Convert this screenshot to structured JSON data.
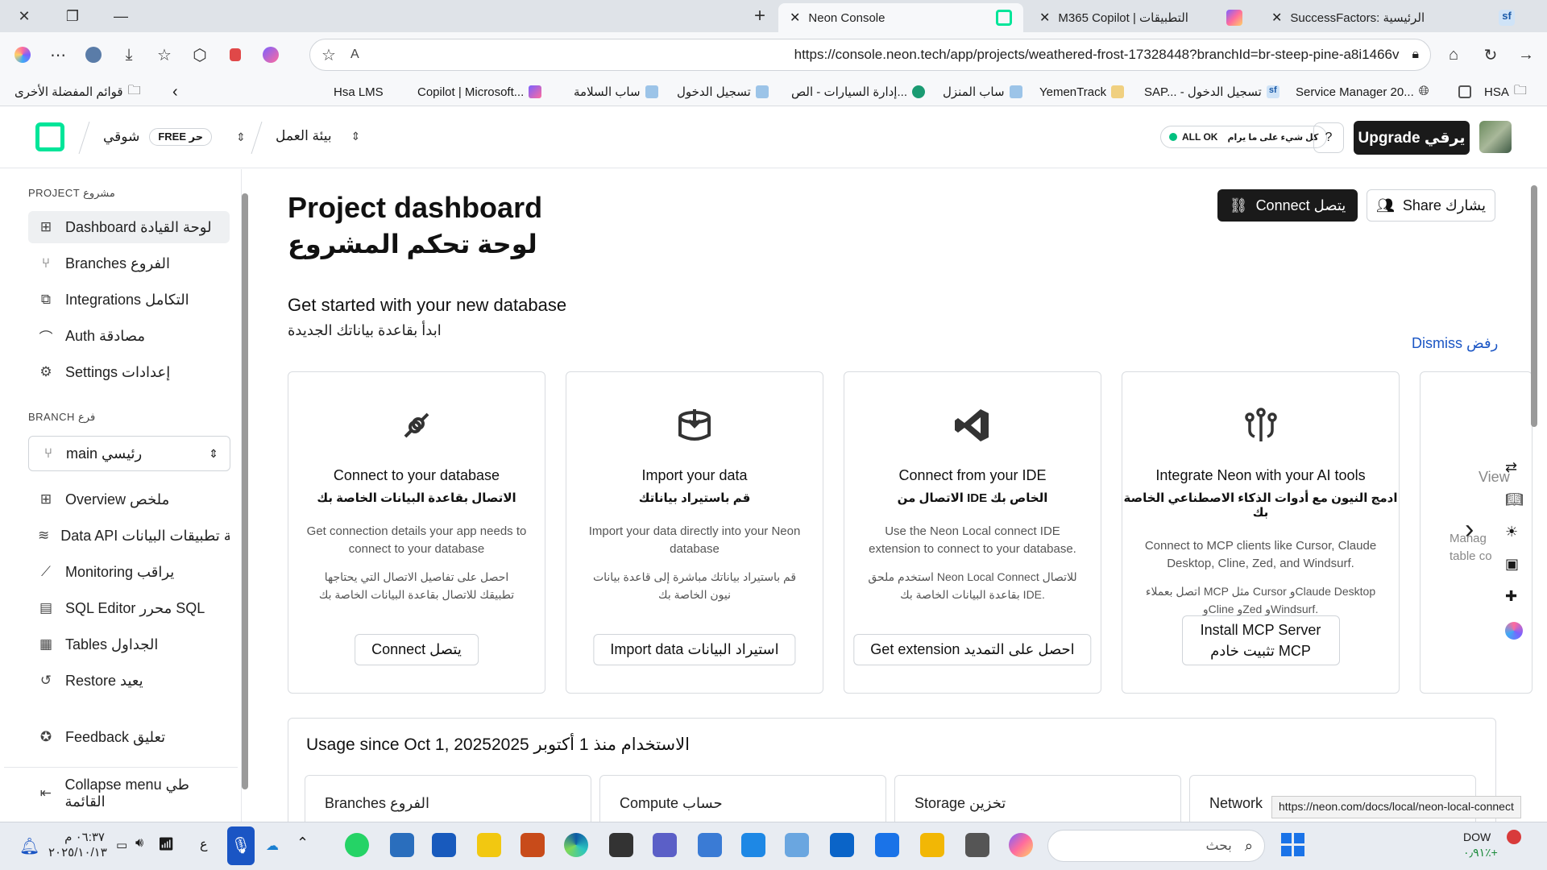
{
  "browser": {
    "tabs": [
      {
        "title": "Neon Console",
        "active": true
      },
      {
        "title": "M365 Copilot | التطبيقات",
        "active": false
      },
      {
        "title": "SuccessFactors: الرئيسية",
        "active": false
      }
    ],
    "url": "https://console.neon.tech/app/projects/weathered-frost-17328448?branchId=br-steep-pine-a8i1466v",
    "bookmarks": [
      "Hsa LMS",
      "Copilot | Microsoft...",
      "ساب السلامة",
      "تسجيل الدخول",
      "إدارة السيارات - الص...",
      "ساب المنزل",
      "YemenTrack",
      "SAP... - تسجيل الدخول",
      "Service Manager 20...",
      "HSA"
    ],
    "other_favorites": "قوائم المفضلة الأخرى"
  },
  "header": {
    "org_name": "شوقي",
    "plan_badge": "FREE حر",
    "workspace": "بيئة العمل",
    "status_label": "ALL OK",
    "status_sub": "كل شيء على ما يرام",
    "help_icon": "?",
    "upgrade_label": "Upgrade يرقي"
  },
  "sidebar": {
    "project_section": "PROJECT مشروع",
    "project_items": [
      {
        "label": "Dashboard لوحة القيادة",
        "icon": "dashboard-icon"
      },
      {
        "label": "Branches الفروع",
        "icon": "branch-icon"
      },
      {
        "label": "Integrations التكامل",
        "icon": "integrations-icon"
      },
      {
        "label": "Auth مصادقة",
        "icon": "auth-icon"
      },
      {
        "label": "Settings إعدادات",
        "icon": "gear-icon"
      }
    ],
    "branch_section": "BRANCH فرع",
    "branch_value": "main رئيسي",
    "branch_items": [
      {
        "label": "Overview ملخص",
        "icon": "overview-icon"
      },
      {
        "label": "Data API برمجة تطبيقات البيانات",
        "icon": "data-api-icon"
      },
      {
        "label": "Monitoring يراقب",
        "icon": "monitoring-icon"
      },
      {
        "label": "SQL Editor محرر SQL",
        "icon": "sql-icon"
      },
      {
        "label": "Tables الجداول",
        "icon": "tables-icon"
      },
      {
        "label": "Restore يعيد",
        "icon": "restore-icon"
      }
    ],
    "feedback": "Feedback تعليق",
    "collapse": "Collapse menu طي القائمة"
  },
  "main": {
    "title": "Project dashboard",
    "title_ar": "لوحة تحكم المشروع",
    "connect_button": "Connect يتصل",
    "share_button": "Share يشارك",
    "get_started": "Get started with your new database",
    "get_started_ar": "ابدأ بقاعدة بياناتك الجديدة",
    "dismiss": "Dismiss رفض",
    "cards": [
      {
        "title": "Connect to your database",
        "title_ar": "الاتصال بقاعدة البيانات الخاصة بك",
        "desc": "Get connection details your app needs to connect to your database",
        "desc_ar": "احصل على تفاصيل الاتصال التي يحتاجها تطبيقك للاتصال بقاعدة البيانات الخاصة بك",
        "button": "Connect يتصل"
      },
      {
        "title": "Import your data",
        "title_ar": "قم باستيراد بياناتك",
        "desc": "Import your data directly into your Neon database",
        "desc_ar": "قم باستيراد بياناتك مباشرة إلى قاعدة بيانات نيون الخاصة بك",
        "button": "Import data استيراد البيانات"
      },
      {
        "title": "Connect from your IDE",
        "title_ar": "الاتصال من IDE الخاص بك",
        "desc": "Use the Neon Local connect IDE extension to connect to your database.",
        "desc_ar": "استخدم ملحق Neon Local Connect للاتصال بقاعدة البيانات الخاصة بك IDE.",
        "button": "Get extension احصل على التمديد"
      },
      {
        "title": "Integrate Neon with your AI tools",
        "title_ar": "ادمج النيون مع أدوات الذكاء الاصطناعي الخاصة بك",
        "desc": "Connect to MCP clients like Cursor, Claude Desktop, Cline, Zed, and Windsurf.",
        "desc_ar": "اتصل بعملاء MCP مثل Cursor وClaude Desktop وCline وZed وWindsurf.",
        "button": "Install MCP Server تثبيت خادم MCP"
      }
    ],
    "peek_card": {
      "title": "View",
      "desc": "Manag table co"
    },
    "usage_title": "Usage since Oct 1, 2025",
    "usage_title_ar": "2025 الاستخدام منذ 1 أكتوبر",
    "usage_boxes": [
      "Branches الفروع",
      "Compute حساب",
      "Storage تخزين",
      "Network"
    ]
  },
  "status_url": "https://neon.com/docs/local/neon-local-connect",
  "taskbar": {
    "time": "٠٦:٣٧ م",
    "date": "٢٠٢٥/١٠/١٣",
    "search_placeholder": "بحث",
    "stock": "DOW",
    "stock_change": "٠٫٩١٪+",
    "lang": "ع"
  },
  "colors": {
    "brand": "#00e599",
    "dark": "#1a1a1a",
    "link": "#1a55c4"
  }
}
